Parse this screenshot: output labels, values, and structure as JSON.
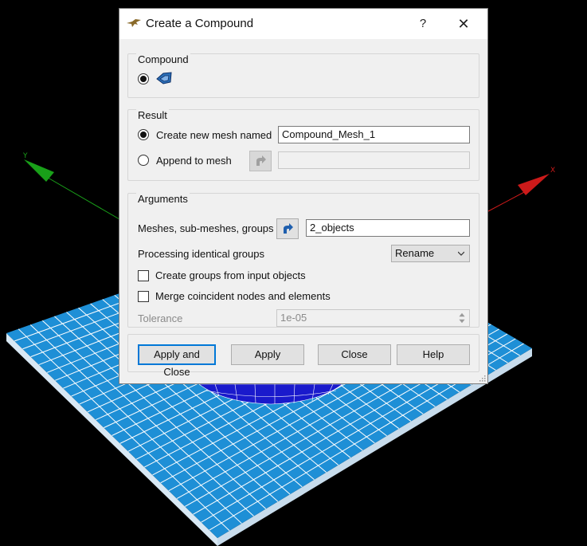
{
  "viewport": {
    "axis_y_label": "Y",
    "axis_x_label": "X",
    "colors": {
      "background": "#000000",
      "mesh_fill": "#1e8fd6",
      "mesh_lines": "#ffffff",
      "cylinder": "#1a1acc",
      "y_axis": "#19a019",
      "x_axis": "#cc1a1a"
    }
  },
  "dialog": {
    "title": "Create a Compound",
    "help_label": "?",
    "close_label": "✕",
    "compound": {
      "group_label": "Compound"
    },
    "result": {
      "group_label": "Result",
      "create_new_label": "Create new mesh named",
      "create_new_selected": true,
      "mesh_name_value": "Compound_Mesh_1",
      "append_label": "Append to mesh",
      "append_selected": false,
      "append_value": ""
    },
    "arguments": {
      "group_label": "Arguments",
      "meshes_label": "Meshes, sub-meshes, groups",
      "meshes_value": "2_objects",
      "processing_label": "Processing identical groups",
      "processing_value": "Rename",
      "create_groups_label": "Create groups from input objects",
      "create_groups_checked": false,
      "merge_label": "Merge coincident nodes and elements",
      "merge_checked": false,
      "tolerance_label": "Tolerance",
      "tolerance_value": "1e-05"
    },
    "buttons": {
      "apply_close": "Apply and Close",
      "apply": "Apply",
      "close": "Close",
      "help": "Help"
    },
    "accent_color": "#0078d7"
  }
}
